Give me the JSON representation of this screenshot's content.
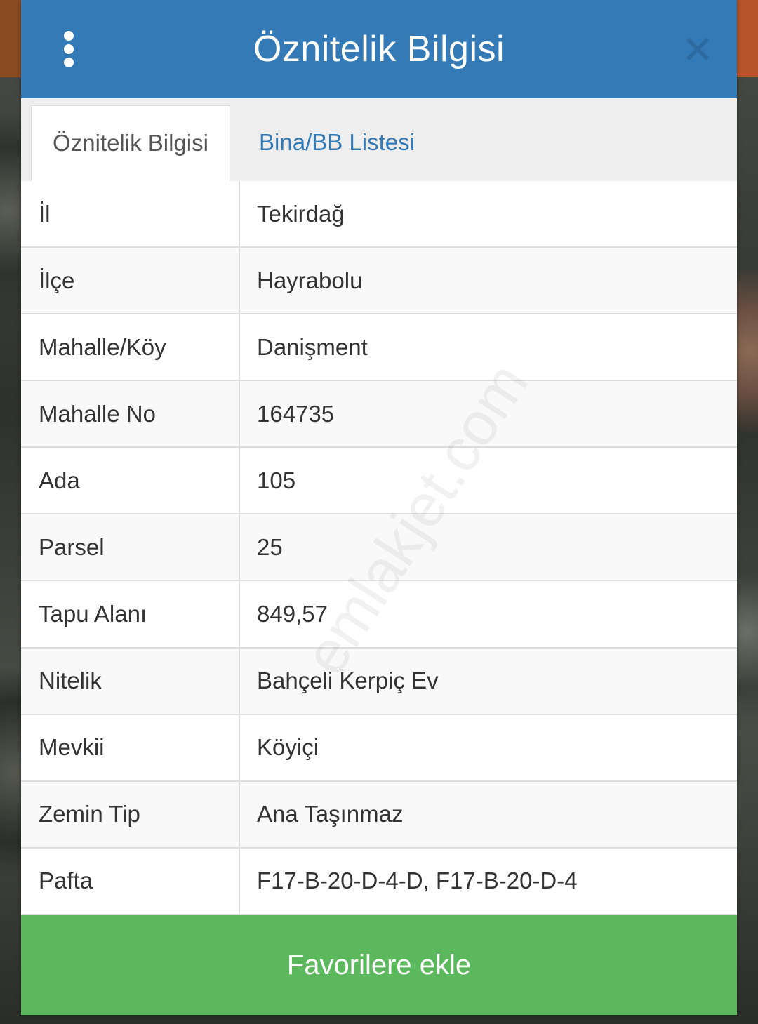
{
  "dialog": {
    "title": "Öznitelik Bilgisi",
    "menu_icon": "vertical-dots-icon",
    "close_icon": "close-icon"
  },
  "tabs": [
    {
      "label": "Öznitelik Bilgisi",
      "active": true
    },
    {
      "label": "Bina/BB Listesi",
      "active": false
    }
  ],
  "attributes": [
    {
      "label": "İl",
      "value": "Tekirdağ"
    },
    {
      "label": "İlçe",
      "value": "Hayrabolu"
    },
    {
      "label": "Mahalle/Köy",
      "value": "Danişment"
    },
    {
      "label": "Mahalle No",
      "value": "164735"
    },
    {
      "label": "Ada",
      "value": "105"
    },
    {
      "label": "Parsel",
      "value": "25"
    },
    {
      "label": "Tapu Alanı",
      "value": "849,57"
    },
    {
      "label": "Nitelik",
      "value": "Bahçeli Kerpiç Ev"
    },
    {
      "label": "Mevkii",
      "value": "Köyiçi"
    },
    {
      "label": "Zemin Tip",
      "value": "Ana Taşınmaz"
    },
    {
      "label": "Pafta",
      "value": "F17-B-20-D-4-D, F17-B-20-D-4"
    }
  ],
  "watermark": "emlakjet.com",
  "actions": {
    "favorite_label": "Favorilere ekle"
  },
  "colors": {
    "header": "#337ab7",
    "tab_link": "#337ab7",
    "favorite_button": "#5cb85c",
    "close_icon": "#2c6aa0"
  }
}
